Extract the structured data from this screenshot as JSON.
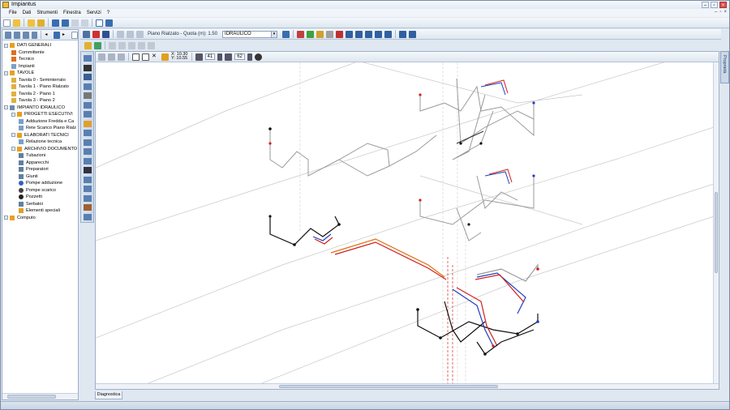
{
  "app": {
    "title": "Impiantus"
  },
  "menu": [
    "File",
    "Dati",
    "Strumenti",
    "Finestra",
    "Servizi",
    "?"
  ],
  "toolbar2": {
    "floor_label": "Piano Rialzato - Quota (m): 1.50",
    "layer_value": "IDRAULICO"
  },
  "canvas": {
    "coord_x": "X: 10.30",
    "coord_y": "Y: 10.55",
    "spin1": "41",
    "spin2": "62"
  },
  "tree": [
    {
      "label": "DATI GENERALI",
      "level": 0,
      "icon": "folder-icon",
      "color": "#e8a020"
    },
    {
      "label": "Committente",
      "level": 1,
      "icon": "person-icon",
      "color": "#e07020"
    },
    {
      "label": "Tecnico",
      "level": 1,
      "icon": "person-icon",
      "color": "#e07020"
    },
    {
      "label": "Impianti",
      "level": 1,
      "icon": "document-icon",
      "color": "#7aa0c8"
    },
    {
      "label": "TAVOLE",
      "level": 0,
      "icon": "folder-icon",
      "color": "#e8a020"
    },
    {
      "label": "Tavola 0 - Seminterrato",
      "level": 1,
      "icon": "sheet-icon",
      "color": "#e0b040"
    },
    {
      "label": "Tavola 1 - Piano Rialzato",
      "level": 1,
      "icon": "sheet-icon",
      "color": "#e0b040"
    },
    {
      "label": "Tavola 2 - Piano 1",
      "level": 1,
      "icon": "sheet-icon",
      "color": "#e0b040"
    },
    {
      "label": "Tavola 3 - Piano 2",
      "level": 1,
      "icon": "sheet-icon",
      "color": "#e0b040"
    },
    {
      "label": "IMPIANTO IDRAULICO",
      "level": 0,
      "icon": "plant-icon",
      "color": "#6a8ab0"
    },
    {
      "label": "PROGETTI ESECUTIVI",
      "level": 1,
      "icon": "folder-icon",
      "color": "#e8a020"
    },
    {
      "label": "Adduzione Fredda e Ca",
      "level": 2,
      "icon": "document-icon",
      "color": "#7aa0c8"
    },
    {
      "label": "Rete Scarico Piano Rialz",
      "level": 2,
      "icon": "document-icon",
      "color": "#7aa0c8"
    },
    {
      "label": "ELABORATI TECNICI",
      "level": 1,
      "icon": "folder-icon",
      "color": "#e8a020"
    },
    {
      "label": "Relazione tecnica",
      "level": 2,
      "icon": "document-icon",
      "color": "#7aa0c8"
    },
    {
      "label": "ARCHIVIO DOCUMENTO",
      "level": 1,
      "icon": "folder-icon",
      "color": "#e8a020"
    },
    {
      "label": "Tubazioni",
      "level": 2,
      "icon": "pipe-icon",
      "color": "#6080a0"
    },
    {
      "label": "Apparecchi",
      "level": 2,
      "icon": "fixture-icon",
      "color": "#6080a0"
    },
    {
      "label": "Preparatori",
      "level": 2,
      "icon": "heater-icon",
      "color": "#6080a0"
    },
    {
      "label": "Giunti",
      "level": 2,
      "icon": "joint-icon",
      "color": "#6080a0"
    },
    {
      "label": "Pompe adduzione",
      "level": 2,
      "icon": "pump-icon",
      "color": "#3060c0"
    },
    {
      "label": "Pompe scarico",
      "level": 2,
      "icon": "pump-icon",
      "color": "#404040"
    },
    {
      "label": "Pozzetti",
      "level": 2,
      "icon": "manhole-icon",
      "color": "#202020"
    },
    {
      "label": "Serbatoi",
      "level": 2,
      "icon": "tank-icon",
      "color": "#6080a0"
    },
    {
      "label": "Elementi speciali",
      "level": 2,
      "icon": "special-icon",
      "color": "#e0a020"
    },
    {
      "label": "Computo",
      "level": 0,
      "icon": "calculator-icon",
      "color": "#e8a020"
    }
  ],
  "bottom_tab": "Diagnostica",
  "right_tab": "Proprietà",
  "colors": {
    "hot": "#d02020",
    "cold": "#2040c0",
    "drain": "#e07010",
    "pipe": "#9a9a9a",
    "black": "#101010"
  }
}
